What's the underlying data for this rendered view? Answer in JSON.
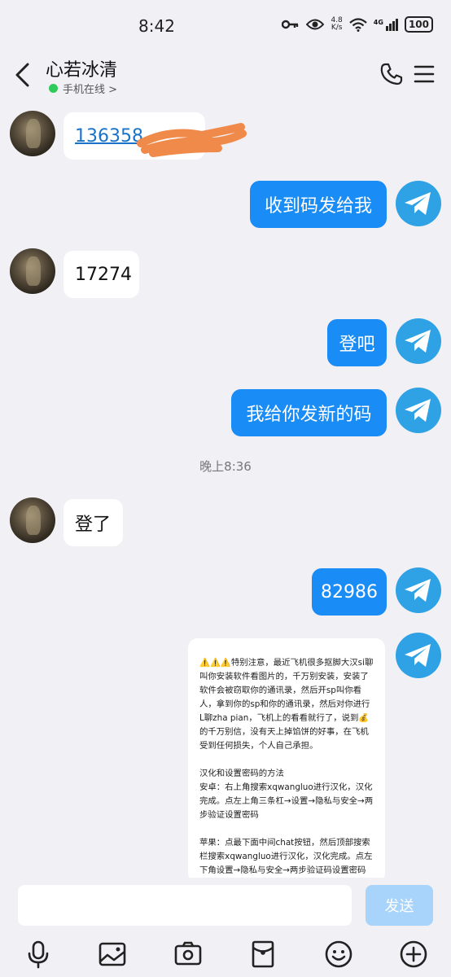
{
  "status_bar": {
    "time": "8:42",
    "net_speed_value": "4.8",
    "net_speed_unit": "K/s",
    "signal_label": "4G",
    "battery": "100"
  },
  "header": {
    "title": "心若冰清",
    "subtitle": "手机在线 >"
  },
  "messages": {
    "m1": "136358",
    "m2": "收到码发给我",
    "m3": "17274",
    "m4": "登吧",
    "m5": "我给你发新的码",
    "m6": "登了",
    "m7": "82986"
  },
  "timestamp": "晚上8:36",
  "card": {
    "p1": "⚠️⚠️⚠️特别注意，最近飞机很多抠脚大汉si聊叫你安装软件看图片的，千万别安装，安装了软件会被窃取你的通讯录，然后开sp叫你看人，拿到你的sp和你的通讯录，然后对你进行L聊zha pian，飞机上的看看就行了，说到💰的千万别信，没有天上掉馅饼的好事，在飞机受到任何损失，个人自己承担。",
    "p2": "汉化和设置密码的方法\n安卓：右上角搜索xqwangluo进行汉化，汉化完成。点左上角三条杠→设置→隐私与安全→两步验证设置密码",
    "p3": "苹果：点最下面中间chat按钮，然后顶部搜索栏搜索xqwangluo进行汉化，汉化完成。点左下角设置→隐私与安全→两步验证码设置密码"
  },
  "input": {
    "placeholder": "",
    "send_label": "发送"
  },
  "colors": {
    "outgoing_bubble": "#1a8cf5",
    "send_button": "#a8d4fb",
    "online": "#2ecb5a",
    "link": "#1a73c7"
  },
  "icons": [
    "back-icon",
    "phone-icon",
    "menu-icon",
    "microphone-icon",
    "image-icon",
    "camera-icon",
    "red-packet-icon",
    "emoji-icon",
    "plus-icon",
    "telegram-icon"
  ]
}
